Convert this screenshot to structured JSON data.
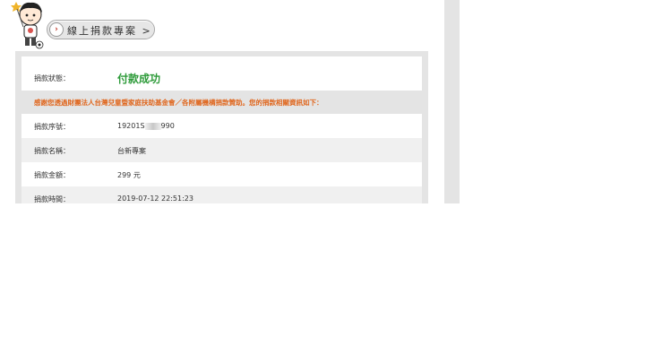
{
  "header": {
    "title": "線上捐款專案 >"
  },
  "receipt": {
    "status": {
      "label": "捐款狀態：",
      "value": "付款成功",
      "value_color": "#2e9b3a"
    },
    "notice": "感謝您透過財團法人台灣兒童暨家庭扶助基金會／各附屬機構捐款贊助。您的捐款相關資訊如下：",
    "notice_color": "#e0661d",
    "rows": [
      {
        "label": "捐款序號：",
        "value": "19201S",
        "value_tail": "990"
      },
      {
        "label": "捐款名稱：",
        "value": "台新專案"
      },
      {
        "label": "捐款金額：",
        "value": "299 元"
      },
      {
        "label": "捐款時間：",
        "value": "2019-07-12 22:51:23"
      }
    ]
  }
}
